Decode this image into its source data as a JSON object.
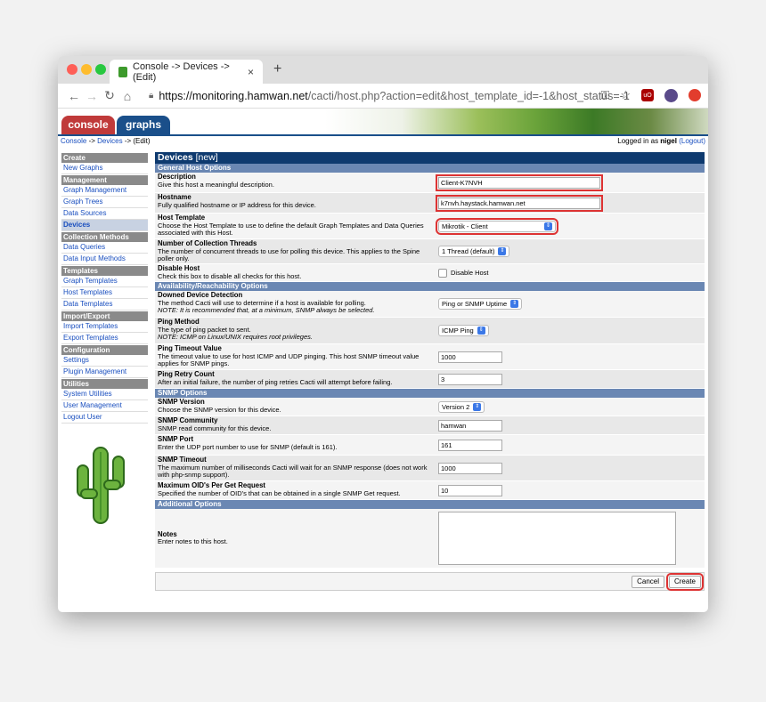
{
  "browser": {
    "tab_title": "Console -> Devices -> (Edit)",
    "close_glyph": "×",
    "new_tab_glyph": "+",
    "url_host": "https://monitoring.hamwan.net",
    "url_path": "/cacti/host.php?action=edit&host_template_id=-1&host_status=-1",
    "ublock_label": "uO"
  },
  "cacti": {
    "tabs": {
      "console": "console",
      "graphs": "graphs"
    },
    "breadcrumb": {
      "console": "Console",
      "sep1": " -> ",
      "devices": "Devices",
      "sep2": " -> ",
      "edit": "(Edit)"
    },
    "login": {
      "prefix": "Logged in as ",
      "user": "nigel",
      "logout": "(Logout)"
    }
  },
  "sidebar": {
    "create": "Create",
    "new_graphs": "New Graphs",
    "management": "Management",
    "graph_management": "Graph Management",
    "graph_trees": "Graph Trees",
    "data_sources": "Data Sources",
    "devices": "Devices",
    "collection_methods": "Collection Methods",
    "data_queries": "Data Queries",
    "data_input_methods": "Data Input Methods",
    "templates": "Templates",
    "graph_templates": "Graph Templates",
    "host_templates": "Host Templates",
    "data_templates": "Data Templates",
    "import_export": "Import/Export",
    "import_templates": "Import Templates",
    "export_templates": "Export Templates",
    "configuration": "Configuration",
    "settings": "Settings",
    "plugin_management": "Plugin Management",
    "utilities": "Utilities",
    "system_utilities": "System Utilities",
    "user_management": "User Management",
    "logout_user": "Logout User"
  },
  "form": {
    "title": "Devices",
    "title_suffix": "[new]",
    "sec_general": "General Host Options",
    "description": {
      "label": "Description",
      "help": "Give this host a meaningful description.",
      "value": "Client-K7NVH"
    },
    "hostname": {
      "label": "Hostname",
      "help": "Fully qualified hostname or IP address for this device.",
      "value": "k7nvh.haystack.hamwan.net"
    },
    "host_template": {
      "label": "Host Template",
      "help": "Choose the Host Template to use to define the default Graph Templates and Data Queries associated with this Host.",
      "value": "Mikrotik - Client"
    },
    "threads": {
      "label": "Number of Collection Threads",
      "help": "The number of concurrent threads to use for polling this device. This applies to the Spine poller only.",
      "value": "1 Thread (default)"
    },
    "disable_host": {
      "label": "Disable Host",
      "help": "Check this box to disable all checks for this host.",
      "value": "Disable Host"
    },
    "sec_availability": "Availability/Reachability Options",
    "downed": {
      "label": "Downed Device Detection",
      "help": "The method Cacti will use to determine if a host is available for polling.",
      "note": "NOTE: It is recommended that, at a minimum, SNMP always be selected.",
      "value": "Ping or SNMP Uptime"
    },
    "ping_method": {
      "label": "Ping Method",
      "help": "The type of ping packet to sent.",
      "note": "NOTE: ICMP on Linux/UNIX requires root privileges.",
      "value": "ICMP Ping"
    },
    "ping_timeout": {
      "label": "Ping Timeout Value",
      "help": "The timeout value to use for host ICMP and UDP pinging. This host SNMP timeout value applies for SNMP pings.",
      "value": "1000"
    },
    "ping_retry": {
      "label": "Ping Retry Count",
      "help": "After an initial failure, the number of ping retries Cacti will attempt before failing.",
      "value": "3"
    },
    "sec_snmp": "SNMP Options",
    "snmp_version": {
      "label": "SNMP Version",
      "help": "Choose the SNMP version for this device.",
      "value": "Version 2"
    },
    "snmp_community": {
      "label": "SNMP Community",
      "help": "SNMP read community for this device.",
      "value": "hamwan"
    },
    "snmp_port": {
      "label": "SNMP Port",
      "help": "Enter the UDP port number to use for SNMP (default is 161).",
      "value": "161"
    },
    "snmp_timeout": {
      "label": "SNMP Timeout",
      "help": "The maximum number of milliseconds Cacti will wait for an SNMP response (does not work with php-snmp support).",
      "value": "1000"
    },
    "max_oids": {
      "label": "Maximum OID's Per Get Request",
      "help": "Specified the number of OID's that can be obtained in a single SNMP Get request.",
      "value": "10"
    },
    "sec_additional": "Additional Options",
    "notes": {
      "label": "Notes",
      "help": "Enter notes to this host."
    },
    "cancel": "Cancel",
    "create": "Create"
  }
}
